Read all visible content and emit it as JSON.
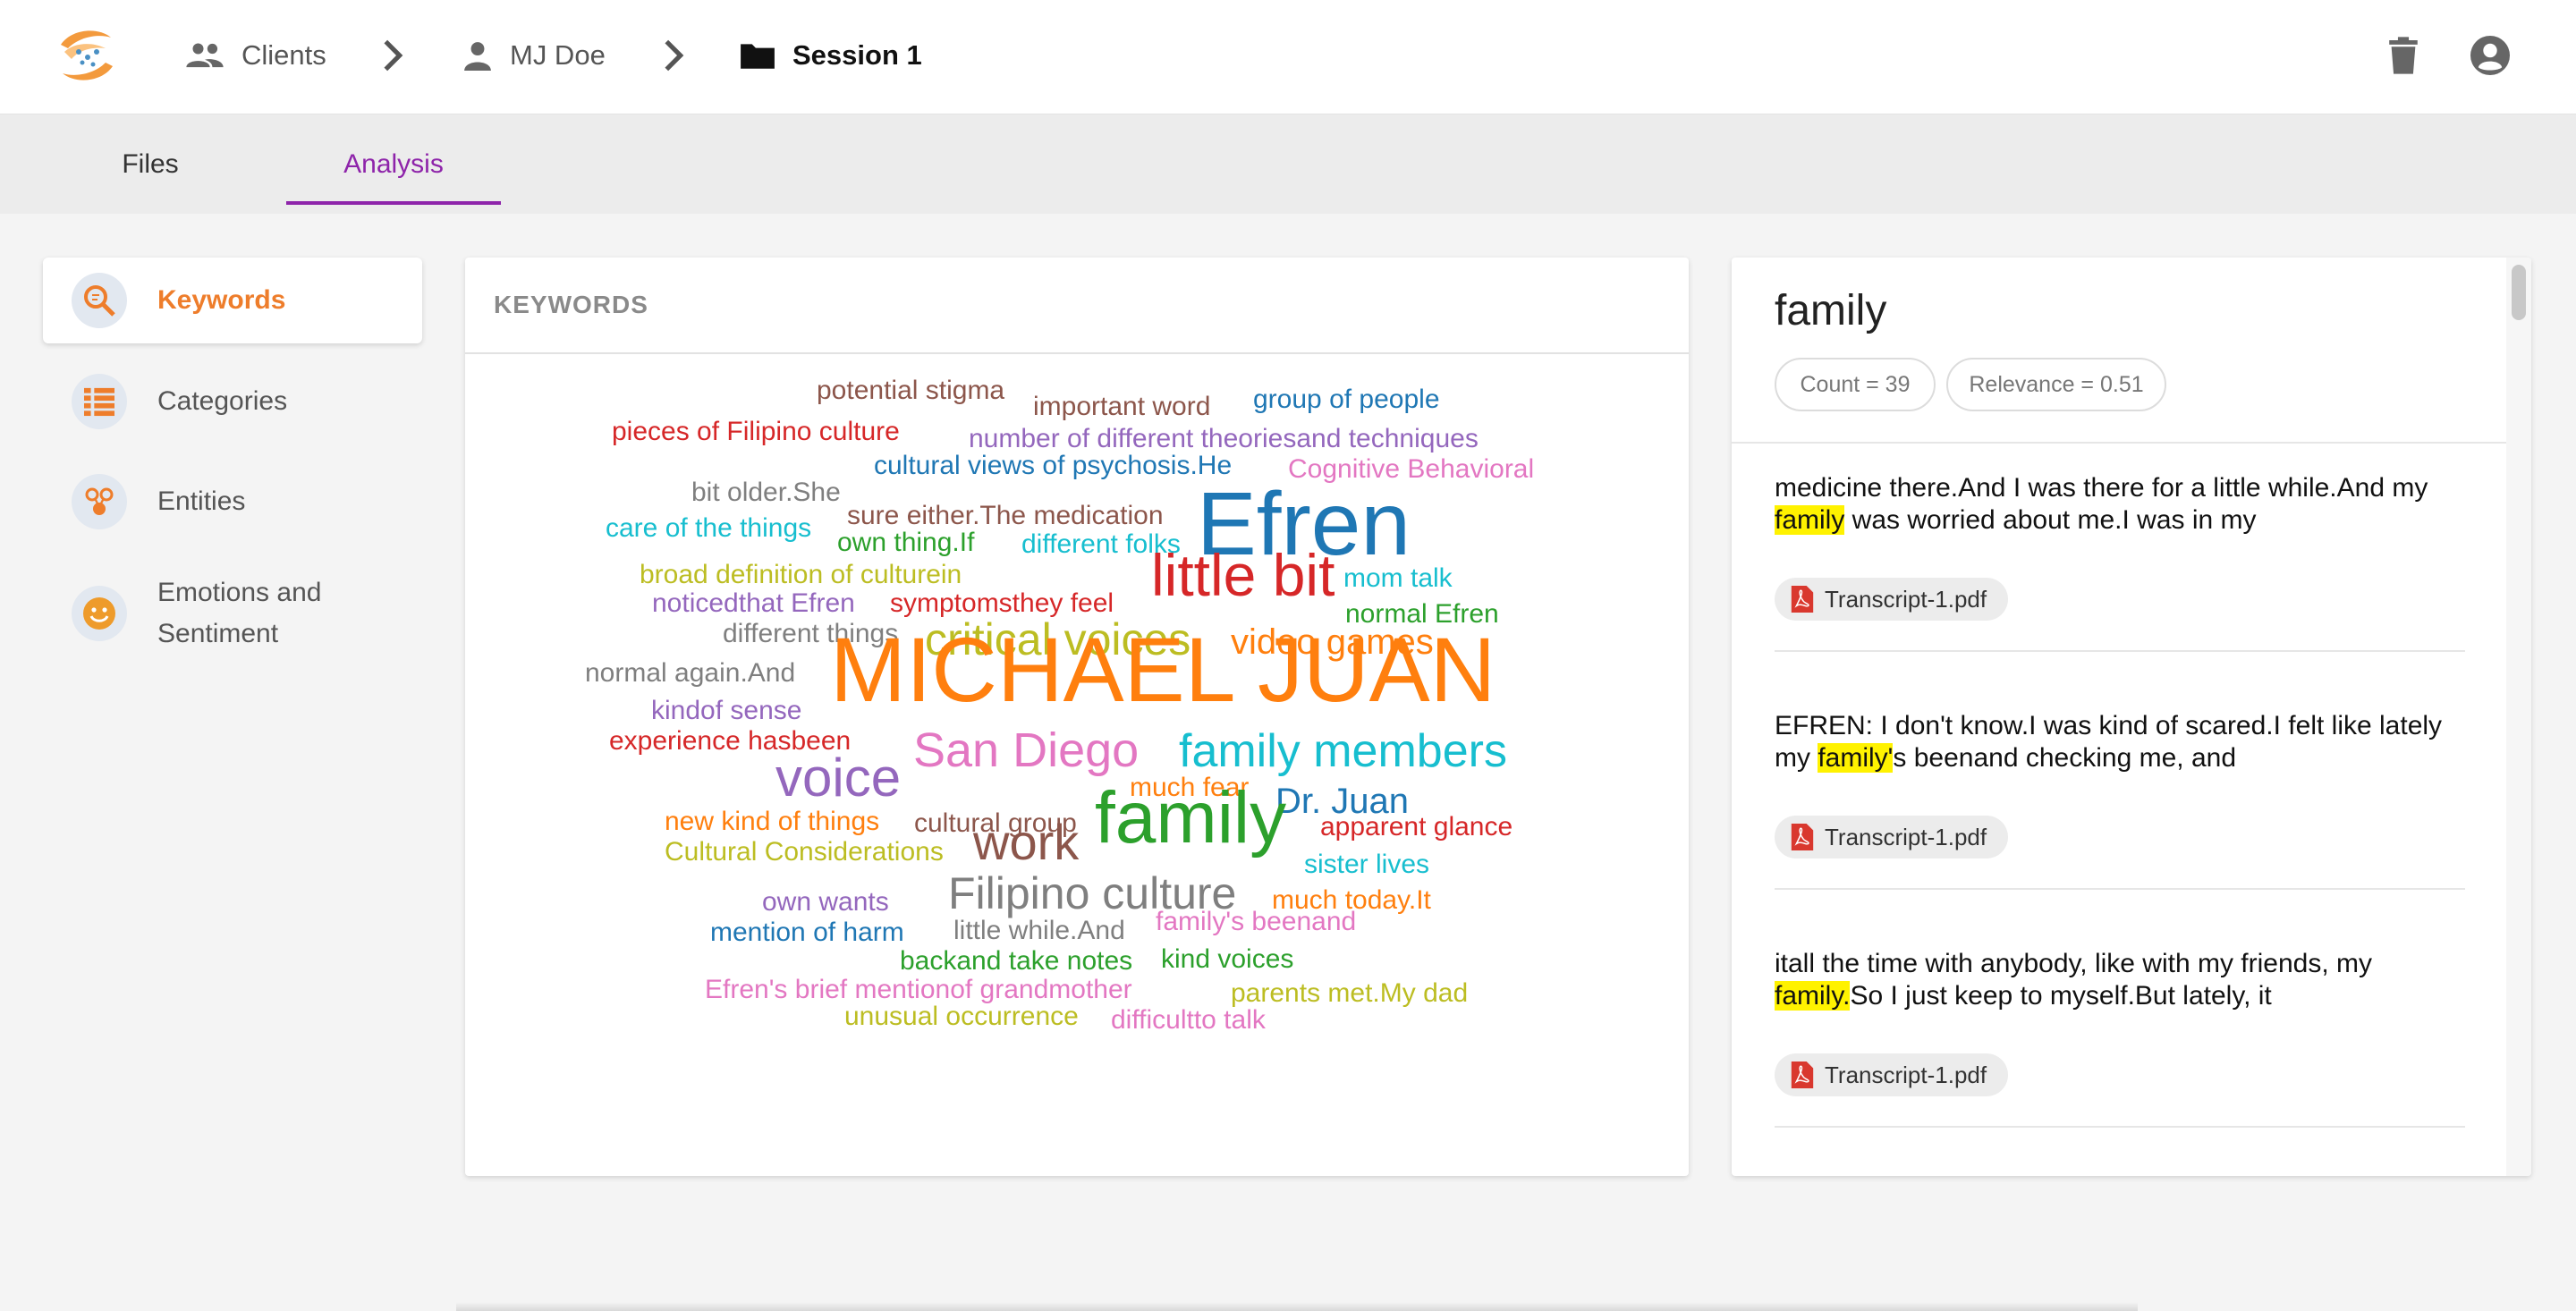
{
  "header": {
    "breadcrumbs": [
      {
        "label": "Clients",
        "icon": "people-icon"
      },
      {
        "label": "MJ Doe",
        "icon": "person-icon"
      },
      {
        "label": "Session 1",
        "icon": "folder-icon"
      }
    ],
    "actions": [
      "trash-icon",
      "account-circle-icon"
    ]
  },
  "tabs": [
    {
      "label": "Files",
      "active": false
    },
    {
      "label": "Analysis",
      "active": true
    }
  ],
  "nav": [
    {
      "label": "Keywords",
      "icon": "keywords-search-icon",
      "active": true
    },
    {
      "label": "Categories",
      "icon": "categories-list-icon",
      "active": false
    },
    {
      "label": "Entities",
      "icon": "entities-icon",
      "active": false
    },
    {
      "label": "Emotions and Sentiment",
      "icon": "smiley-icon",
      "active": false
    }
  ],
  "keywords_panel": {
    "title": "KEYWORDS",
    "words": [
      {
        "text": "potential stigma",
        "color": "#8c564b"
      },
      {
        "text": "important word",
        "color": "#8c564b"
      },
      {
        "text": "group of people",
        "color": "#1f77b4"
      },
      {
        "text": "pieces of Filipino culture",
        "color": "#d62728"
      },
      {
        "text": "number of different theoriesand techniques",
        "color": "#9467bd"
      },
      {
        "text": "cultural views of psychosis.He",
        "color": "#1f77b4"
      },
      {
        "text": "Cognitive Behavioral",
        "color": "#e377c2"
      },
      {
        "text": "bit older.She",
        "color": "#7f7f7f"
      },
      {
        "text": "sure either.The medication",
        "color": "#8c564b"
      },
      {
        "text": "Efren",
        "color": "#1f77b4"
      },
      {
        "text": "care of the things",
        "color": "#17becf"
      },
      {
        "text": "own thing.If",
        "color": "#2ca02c"
      },
      {
        "text": "different folks",
        "color": "#17becf"
      },
      {
        "text": "broad definition of culturein",
        "color": "#bcbd22"
      },
      {
        "text": "little bit",
        "color": "#d62728"
      },
      {
        "text": "mom talk",
        "color": "#17becf"
      },
      {
        "text": "noticedthat Efren",
        "color": "#9467bd"
      },
      {
        "text": "symptomsthey feel",
        "color": "#d62728"
      },
      {
        "text": "normal Efren",
        "color": "#2ca02c"
      },
      {
        "text": "different things",
        "color": "#7f7f7f"
      },
      {
        "text": "critical voices",
        "color": "#bcbd22"
      },
      {
        "text": "video games",
        "color": "#ff7f0e"
      },
      {
        "text": "normal again.And",
        "color": "#7f7f7f"
      },
      {
        "text": "MICHAEL JUAN",
        "color": "#ff7f0e"
      },
      {
        "text": "kindof sense",
        "color": "#9467bd"
      },
      {
        "text": "experience hasbeen",
        "color": "#d62728"
      },
      {
        "text": "San Diego",
        "color": "#e377c2"
      },
      {
        "text": "family members",
        "color": "#17becf"
      },
      {
        "text": "voice",
        "color": "#9467bd"
      },
      {
        "text": "much fear",
        "color": "#ff7f0e"
      },
      {
        "text": "Dr. Juan",
        "color": "#1f77b4"
      },
      {
        "text": "new kind of things",
        "color": "#ff7f0e"
      },
      {
        "text": "cultural group",
        "color": "#8c564b"
      },
      {
        "text": "apparent glance",
        "color": "#d62728"
      },
      {
        "text": "work",
        "color": "#8c564b"
      },
      {
        "text": "family",
        "color": "#2ca02c"
      },
      {
        "text": "Cultural Considerations",
        "color": "#bcbd22"
      },
      {
        "text": "sister lives",
        "color": "#17becf"
      },
      {
        "text": "Filipino culture",
        "color": "#7f7f7f"
      },
      {
        "text": "own wants",
        "color": "#9467bd"
      },
      {
        "text": "much today.It",
        "color": "#ff7f0e"
      },
      {
        "text": "mention of harm",
        "color": "#1f77b4"
      },
      {
        "text": "little while.And",
        "color": "#7f7f7f"
      },
      {
        "text": "family's beenand",
        "color": "#e377c2"
      },
      {
        "text": "backand take notes",
        "color": "#2ca02c"
      },
      {
        "text": "kind voices",
        "color": "#2ca02c"
      },
      {
        "text": "Efren's brief mentionof grandmother",
        "color": "#e377c2"
      },
      {
        "text": "parents met.My dad",
        "color": "#bcbd22"
      },
      {
        "text": "unusual occurrence",
        "color": "#bcbd22"
      },
      {
        "text": "difficultto talk",
        "color": "#e377c2"
      }
    ]
  },
  "detail": {
    "term": "family",
    "count_label": "Count = 39",
    "relevance_label": "Relevance = 0.51",
    "excerpts": [
      {
        "before": "medicine there.And I was there for a little while.And my ",
        "match": "family",
        "after": " was worried about me.I was in my",
        "file": "Transcript-1.pdf"
      },
      {
        "before": "EFREN: I don't know.I was kind of scared.I felt like lately my ",
        "match": "family'",
        "after": "s beenand checking me, and",
        "file": "Transcript-1.pdf"
      },
      {
        "before": "itall the time with anybody, like with my friends, my ",
        "match": "family.",
        "after": "So I just keep to myself.But lately, it",
        "file": "Transcript-1.pdf"
      }
    ]
  }
}
